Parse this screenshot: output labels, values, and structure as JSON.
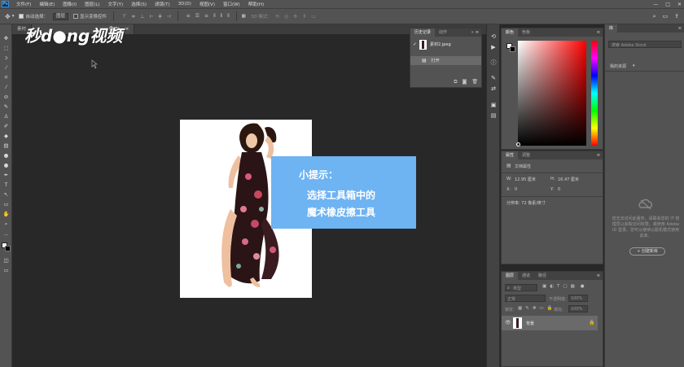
{
  "menubar": {
    "logo": "Ps",
    "items": [
      "文件(F)",
      "编辑(E)",
      "图像(I)",
      "图层(L)",
      "文字(Y)",
      "选择(S)",
      "滤镜(T)",
      "3D(D)",
      "视图(V)",
      "窗口(W)",
      "帮助(H)"
    ],
    "window_controls": [
      "—",
      "□",
      "✕"
    ]
  },
  "options": {
    "auto_select_label": "自动选择：",
    "auto_select_value": "图层",
    "show_transform_label": "显示变换控件",
    "mode_3d_label": "3D 模式："
  },
  "tabs": [
    {
      "label": "素材"
    },
    {
      "label": "像/8)"
    }
  ],
  "watermark": "秒d●ng视频",
  "tip": {
    "title": "小提示：",
    "line1": "选择工具箱中的",
    "line2": "魔术橡皮擦工具"
  },
  "history_panel": {
    "tabs": [
      "历史记录",
      "动作"
    ],
    "snapshot_label": "素材2.jpeg",
    "step_label": "打开"
  },
  "color_panel": {
    "tabs": [
      "颜色",
      "色板"
    ]
  },
  "properties_panel": {
    "tabs": [
      "属性",
      "调整"
    ],
    "doc_label": "文档属性",
    "w_label": "W:",
    "w_value": "12.95 厘米",
    "h_label": "H:",
    "h_value": "16.47 厘米",
    "x_label": "X:",
    "x_value": "0",
    "y_label": "Y:",
    "y_value": "0",
    "resolution": "分辨率: 72 像素/英寸"
  },
  "layers_panel": {
    "tabs": [
      "图层",
      "通道",
      "路径"
    ],
    "kind_label": "类型",
    "blend_mode": "正常",
    "opacity_label": "不透明度:",
    "opacity_value": "100%",
    "lock_label": "锁定:",
    "fill_label": "填充:",
    "fill_value": "100%",
    "layer_name": "背景"
  },
  "library_panel": {
    "tab": "库",
    "search_placeholder": "搜索 Adobe Stock",
    "dropdown": "我的资源",
    "message": "您无法访问此服务，请联系您的 IT 管理员以获取访问权限，或使用 Adobe ID 登录。您可以继续以脱机模式使用此库。",
    "create_button": "+ 创建新库"
  },
  "colors": {
    "accent_tip": "#6eb3f2",
    "canvas_bg": "#282828",
    "panel_bg": "#535353"
  }
}
